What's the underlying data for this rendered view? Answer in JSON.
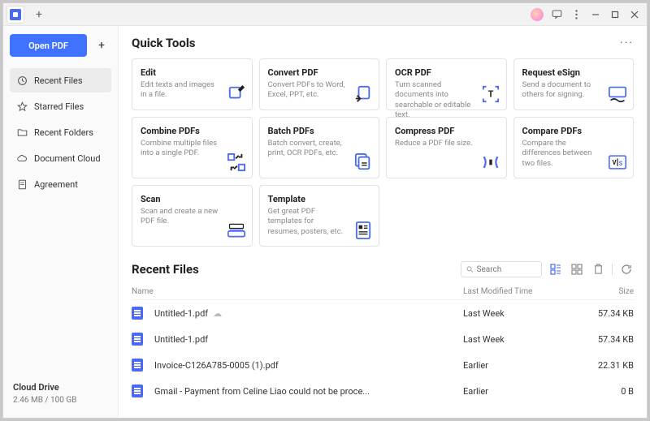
{
  "titlebar": {
    "new_tab_tooltip": "+"
  },
  "sidebar": {
    "open_label": "Open PDF",
    "items": [
      {
        "label": "Recent Files",
        "icon": "clock"
      },
      {
        "label": "Starred Files",
        "icon": "star"
      },
      {
        "label": "Recent Folders",
        "icon": "folder"
      },
      {
        "label": "Document Cloud",
        "icon": "cloud"
      },
      {
        "label": "Agreement",
        "icon": "doc"
      }
    ],
    "footer": {
      "label": "Cloud Drive",
      "usage": "2.46 MB / 100 GB"
    }
  },
  "quick_tools": {
    "title": "Quick Tools",
    "cards": [
      {
        "title": "Edit",
        "desc": "Edit texts and images in a file."
      },
      {
        "title": "Convert PDF",
        "desc": "Convert PDFs to Word, Excel, PPT, etc."
      },
      {
        "title": "OCR PDF",
        "desc": "Turn scanned documents into searchable or editable text."
      },
      {
        "title": "Request eSign",
        "desc": "Send a document to others for signing."
      },
      {
        "title": "Combine PDFs",
        "desc": "Combine multiple files into a single PDF."
      },
      {
        "title": "Batch PDFs",
        "desc": "Batch convert, create, print, OCR PDFs, etc."
      },
      {
        "title": "Compress PDF",
        "desc": "Reduce a PDF file size."
      },
      {
        "title": "Compare PDFs",
        "desc": "Compare the differences between two files."
      },
      {
        "title": "Scan",
        "desc": "Scan and create a new PDF file."
      },
      {
        "title": "Template",
        "desc": "Get great PDF templates for resumes, posters, etc."
      }
    ]
  },
  "recent": {
    "title": "Recent Files",
    "search_placeholder": "Search",
    "columns": {
      "name": "Name",
      "modified": "Last Modified Time",
      "size": "Size"
    },
    "files": [
      {
        "name": "Untitled-1.pdf",
        "modified": "Last Week",
        "size": "57.34 KB",
        "cloud": true
      },
      {
        "name": "Untitled-1.pdf",
        "modified": "Last Week",
        "size": "57.34 KB",
        "cloud": false
      },
      {
        "name": "Invoice-C126A785-0005 (1).pdf",
        "modified": "Earlier",
        "size": "22.31 KB",
        "cloud": false
      },
      {
        "name": "Gmail - Payment from Celine Liao could not be proce...",
        "modified": "Earlier",
        "size": "0 B",
        "cloud": false
      }
    ]
  }
}
